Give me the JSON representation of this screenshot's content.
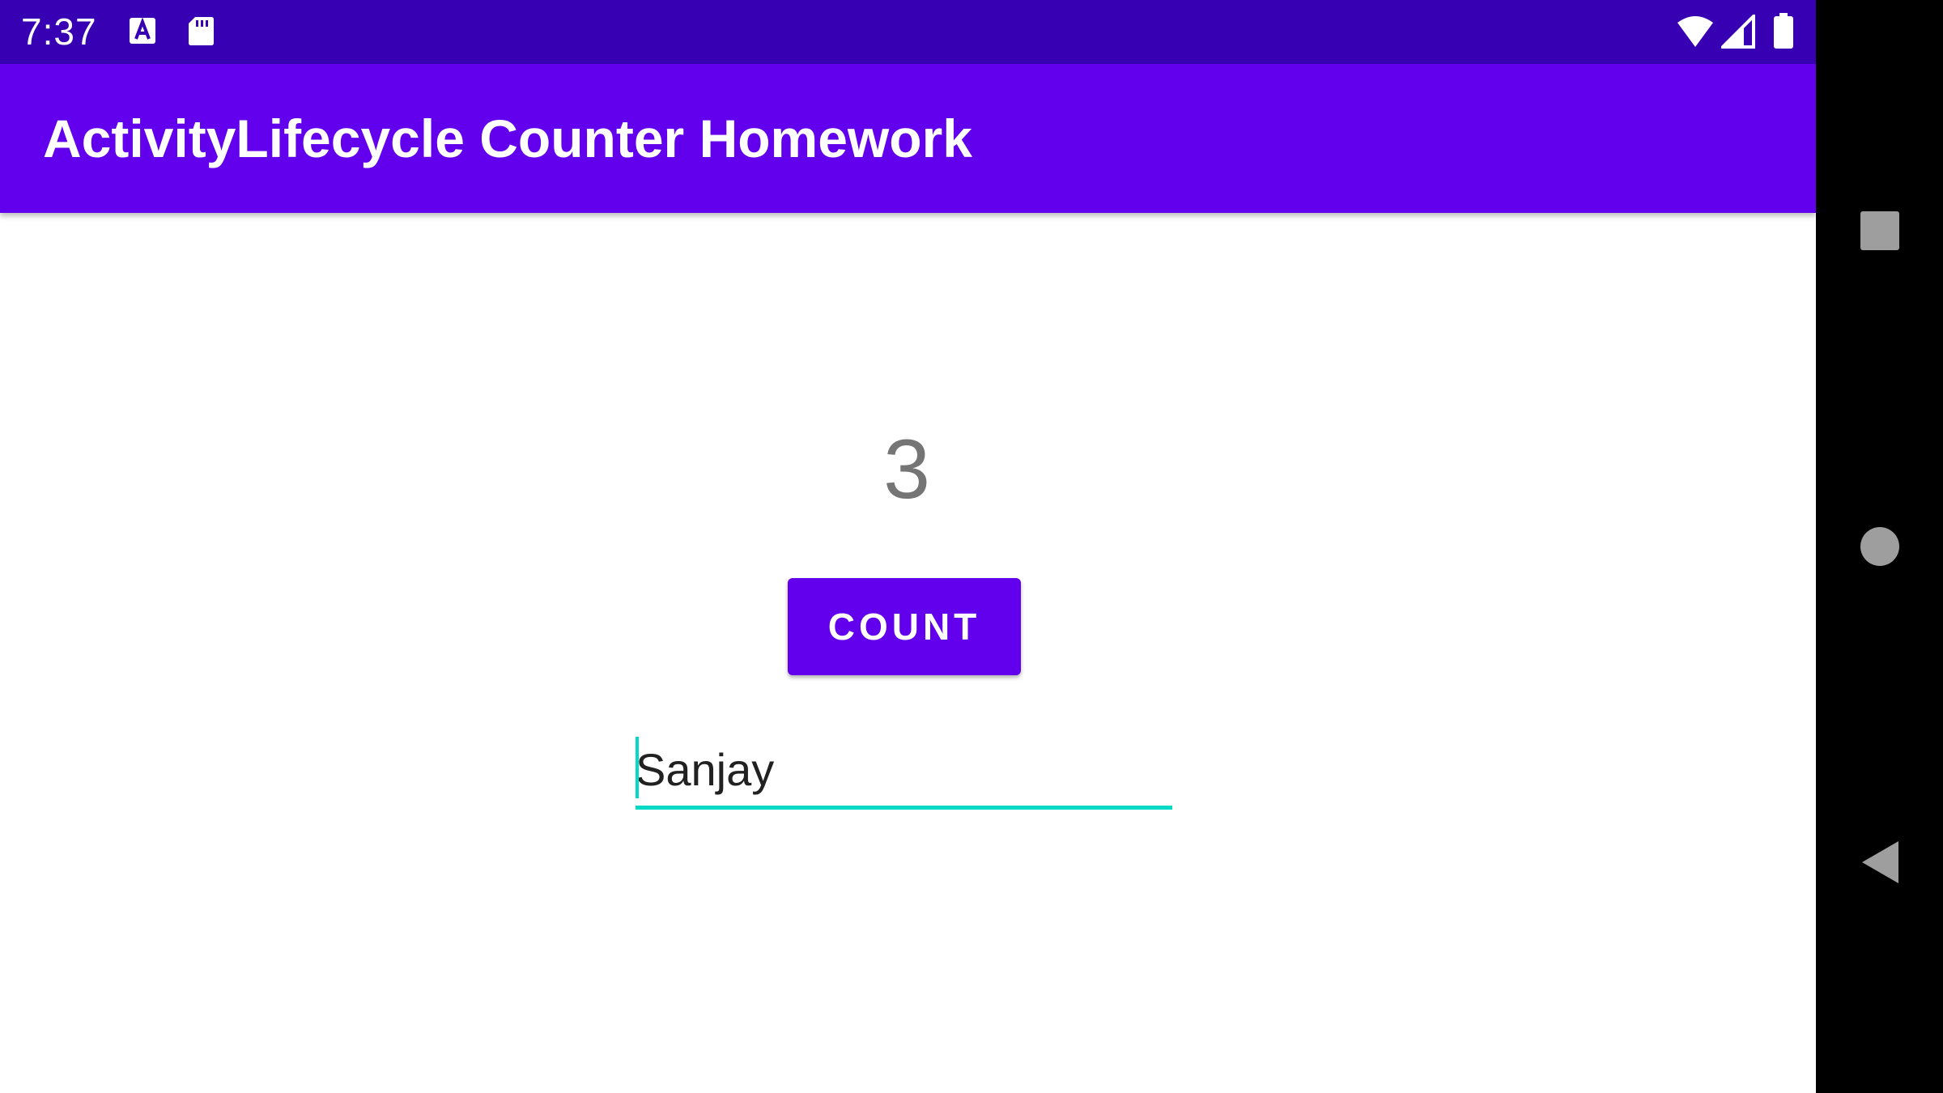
{
  "status_bar": {
    "time": "7:37",
    "icons": [
      "font-notification-icon",
      "sd-card-icon",
      "wifi-icon",
      "cell-signal-icon",
      "battery-icon"
    ],
    "background": "#3700b3"
  },
  "app_bar": {
    "title": "ActivityLifecycle Counter Homework",
    "background": "#6200ee"
  },
  "main": {
    "count_value": "3",
    "count_button_label": "COUNT",
    "name_input_value": "Sanjay",
    "accent": "#03dac5"
  },
  "nav_bar": {
    "buttons": [
      "recents-icon",
      "home-icon",
      "back-icon"
    ]
  }
}
